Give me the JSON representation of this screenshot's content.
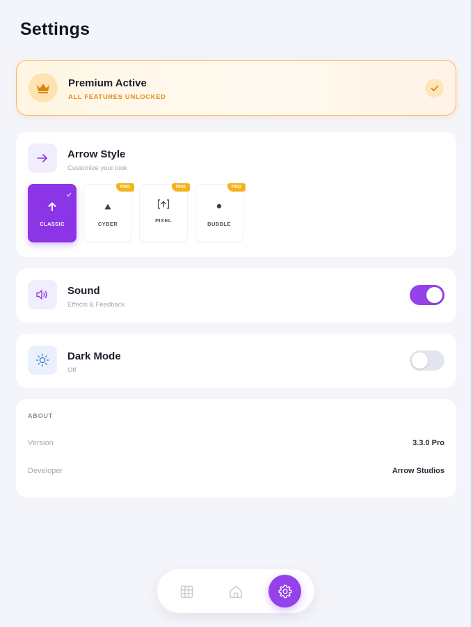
{
  "page": {
    "title": "Settings"
  },
  "premium": {
    "title": "Premium Active",
    "subtitle": "ALL FEATURES UNLOCKED",
    "icon": "crown-icon",
    "check_icon": "check-icon"
  },
  "arrow_style": {
    "title": "Arrow Style",
    "subtitle": "Customize your look",
    "icon": "arrow-right-icon",
    "options": [
      {
        "label": "CLASSIC",
        "selected": true,
        "pro": false,
        "icon": "arrow-up-icon"
      },
      {
        "label": "CYBER",
        "selected": false,
        "pro": true,
        "badge": "PRO",
        "icon": "triangle-icon"
      },
      {
        "label": "PIXEL",
        "selected": false,
        "pro": true,
        "badge": "PRO",
        "icon": "bracket-arrow-icon"
      },
      {
        "label": "BUBBLE",
        "selected": false,
        "pro": true,
        "badge": "PRO",
        "icon": "dot-icon"
      }
    ]
  },
  "sound": {
    "title": "Sound",
    "subtitle": "Effects & Feedback",
    "icon": "speaker-icon",
    "enabled": true
  },
  "dark_mode": {
    "title": "Dark Mode",
    "subtitle": "Off",
    "icon": "sun-icon",
    "enabled": false
  },
  "about": {
    "heading": "ABOUT",
    "rows": [
      {
        "key": "Version",
        "value": "3.3.0 Pro"
      },
      {
        "key": "Developer",
        "value": "Arrow Studios"
      }
    ]
  },
  "nav": {
    "items": [
      {
        "icon": "grid-icon",
        "active": false
      },
      {
        "icon": "home-icon",
        "active": false
      },
      {
        "icon": "gear-icon",
        "active": true
      }
    ]
  },
  "colors": {
    "accent": "#9442ea",
    "premium_orange": "#e98a1f",
    "pro_badge": "#f6b21b",
    "background": "#f4f5fa"
  }
}
